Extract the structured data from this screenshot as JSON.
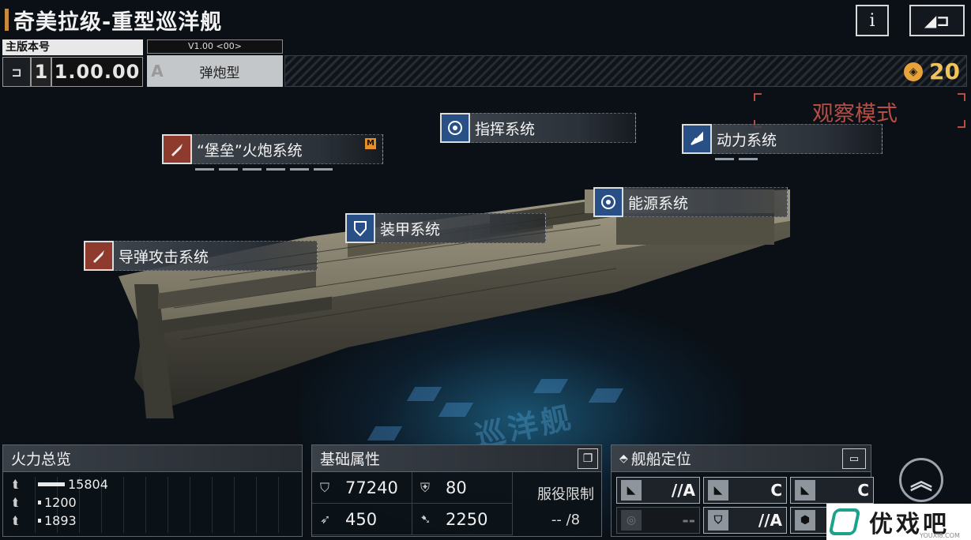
{
  "title": "奇美拉级-重型巡洋舰",
  "header": {
    "info_label": "i",
    "back_label": "◢⊐"
  },
  "version": {
    "label": "主版本号",
    "number": "1",
    "value": "1.00.00"
  },
  "variant": {
    "version_text": "V1.00 <00>",
    "letter": "A",
    "name": "弹炮型"
  },
  "credits": {
    "icon": "hex-coin-icon",
    "value": "20"
  },
  "mode_label": "观察模式",
  "systems": [
    {
      "label": "“堡垒”火炮系统",
      "icon": "shell-icon",
      "badge": "M"
    },
    {
      "label": "指挥系统",
      "icon": "radar-icon"
    },
    {
      "label": "动力系统",
      "icon": "engine-icon"
    },
    {
      "label": "能源系统",
      "icon": "radar-icon"
    },
    {
      "label": "装甲系统",
      "icon": "shield-icon"
    },
    {
      "label": "导弹攻击系统",
      "icon": "shell-icon"
    }
  ],
  "holo_label": "巡洋舰",
  "firepower": {
    "title": "火力总览",
    "rows": [
      {
        "value": "15804",
        "level": 1.0
      },
      {
        "value": "1200",
        "level": 0.08
      },
      {
        "value": "1893",
        "level": 0.12
      }
    ]
  },
  "attributes": {
    "title": "基础属性",
    "items": [
      {
        "icon": "shield-icon",
        "value": "77240"
      },
      {
        "icon": "armor-icon",
        "value": "80"
      },
      {
        "icon": "speed-icon",
        "value": "450"
      },
      {
        "icon": "warp-icon",
        "value": "2250"
      }
    ],
    "service_title": "服役限制",
    "service_value": "--  /8"
  },
  "positioning": {
    "title": "舰船定位",
    "cells": [
      {
        "rank": "//A",
        "dim": false
      },
      {
        "rank": "C",
        "dim": false
      },
      {
        "rank": "C",
        "dim": false
      },
      {
        "rank": "--",
        "dim": true
      },
      {
        "rank": "//A",
        "dim": false
      },
      {
        "rank": "",
        "dim": false
      }
    ]
  },
  "watermark": {
    "text": "优戏吧",
    "sub": "YOUXI8.COM"
  },
  "colors": {
    "accent": "#c98a3c",
    "observe": "#b84d43",
    "credits": "#f0c45a",
    "system_red": "#8e3a2c",
    "system_blue": "#284f86"
  }
}
